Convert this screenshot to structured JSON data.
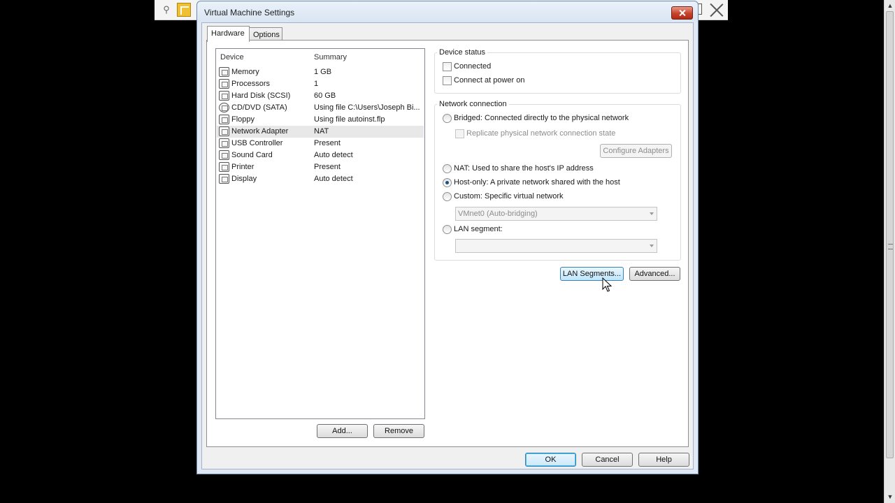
{
  "dialog": {
    "title": "Virtual Machine Settings"
  },
  "tabs": [
    {
      "label": "Hardware",
      "active": true
    },
    {
      "label": "Options",
      "active": false
    }
  ],
  "device_list": {
    "columns": [
      "Device",
      "Summary"
    ],
    "rows": [
      {
        "device": "Memory",
        "summary": "1 GB",
        "icon": "memory-icon"
      },
      {
        "device": "Processors",
        "summary": "1",
        "icon": "processor-icon"
      },
      {
        "device": "Hard Disk (SCSI)",
        "summary": "60 GB",
        "icon": "hard-disk-icon"
      },
      {
        "device": "CD/DVD (SATA)",
        "summary": "Using file C:\\Users\\Joseph Bi...",
        "icon": "cd-dvd-icon"
      },
      {
        "device": "Floppy",
        "summary": "Using file autoinst.flp",
        "icon": "floppy-icon"
      },
      {
        "device": "Network Adapter",
        "summary": "NAT",
        "icon": "network-adapter-icon",
        "selected": true
      },
      {
        "device": "USB Controller",
        "summary": "Present",
        "icon": "usb-icon"
      },
      {
        "device": "Sound Card",
        "summary": "Auto detect",
        "icon": "sound-card-icon"
      },
      {
        "device": "Printer",
        "summary": "Present",
        "icon": "printer-icon"
      },
      {
        "device": "Display",
        "summary": "Auto detect",
        "icon": "display-icon"
      }
    ],
    "add_label": "Add...",
    "remove_label": "Remove"
  },
  "device_status": {
    "title": "Device status",
    "connected_label": "Connected",
    "connected": false,
    "power_on_label": "Connect at power on",
    "power_on": false
  },
  "network_connection": {
    "title": "Network connection",
    "bridged_label": "Bridged: Connected directly to the physical network",
    "replicate_label": "Replicate physical network connection state",
    "configure_label": "Configure Adapters",
    "nat_label": "NAT: Used to share the host's IP address",
    "hostonly_label": "Host-only: A private network shared with the host",
    "custom_label": "Custom: Specific virtual network",
    "custom_value": "VMnet0 (Auto-bridging)",
    "lan_label": "LAN segment:",
    "lan_value": "",
    "selected": "host-only"
  },
  "actions": {
    "lan_segments_label": "LAN Segments...",
    "advanced_label": "Advanced..."
  },
  "footer": {
    "ok_label": "OK",
    "cancel_label": "Cancel",
    "help_label": "Help"
  },
  "colors": {
    "accent": "#3c7fb1",
    "close": "#c7422b",
    "selected_row": "#e8e8e8"
  }
}
